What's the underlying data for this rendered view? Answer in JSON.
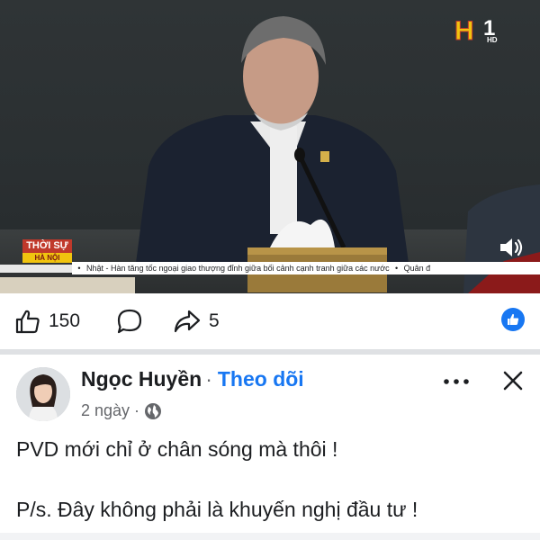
{
  "video": {
    "channel_logo": {
      "main": "H",
      "number": "1",
      "hd": "HD"
    },
    "program_badge": {
      "top": "THỜI SỰ",
      "bottom": "HÀ NỘI"
    },
    "ticker_text": "Nhật - Hàn tăng tốc ngoại giao thượng đỉnh giữa bối cảnh cạnh tranh giữa các nước",
    "ticker_next": "Quân đ",
    "volume_icon": "speaker-icon"
  },
  "actions": {
    "like_count": "150",
    "comment_count": "",
    "share_count": "5",
    "reaction_icon": "like-reaction-icon"
  },
  "post": {
    "author_name": "Ngọc Huyền",
    "separator": "·",
    "follow_label": "Theo dõi",
    "time": "2 ngày",
    "meta_separator": "·",
    "privacy_icon": "globe-icon",
    "line1": "PVD mới chỉ ở chân sóng mà thôi !",
    "line2": "P/s. Đây không phải là khuyến nghị đầu tư !"
  },
  "colors": {
    "accent": "#1877f2",
    "text": "#1c1e21",
    "muted": "#65676b",
    "divider": "#dfe1e4"
  }
}
